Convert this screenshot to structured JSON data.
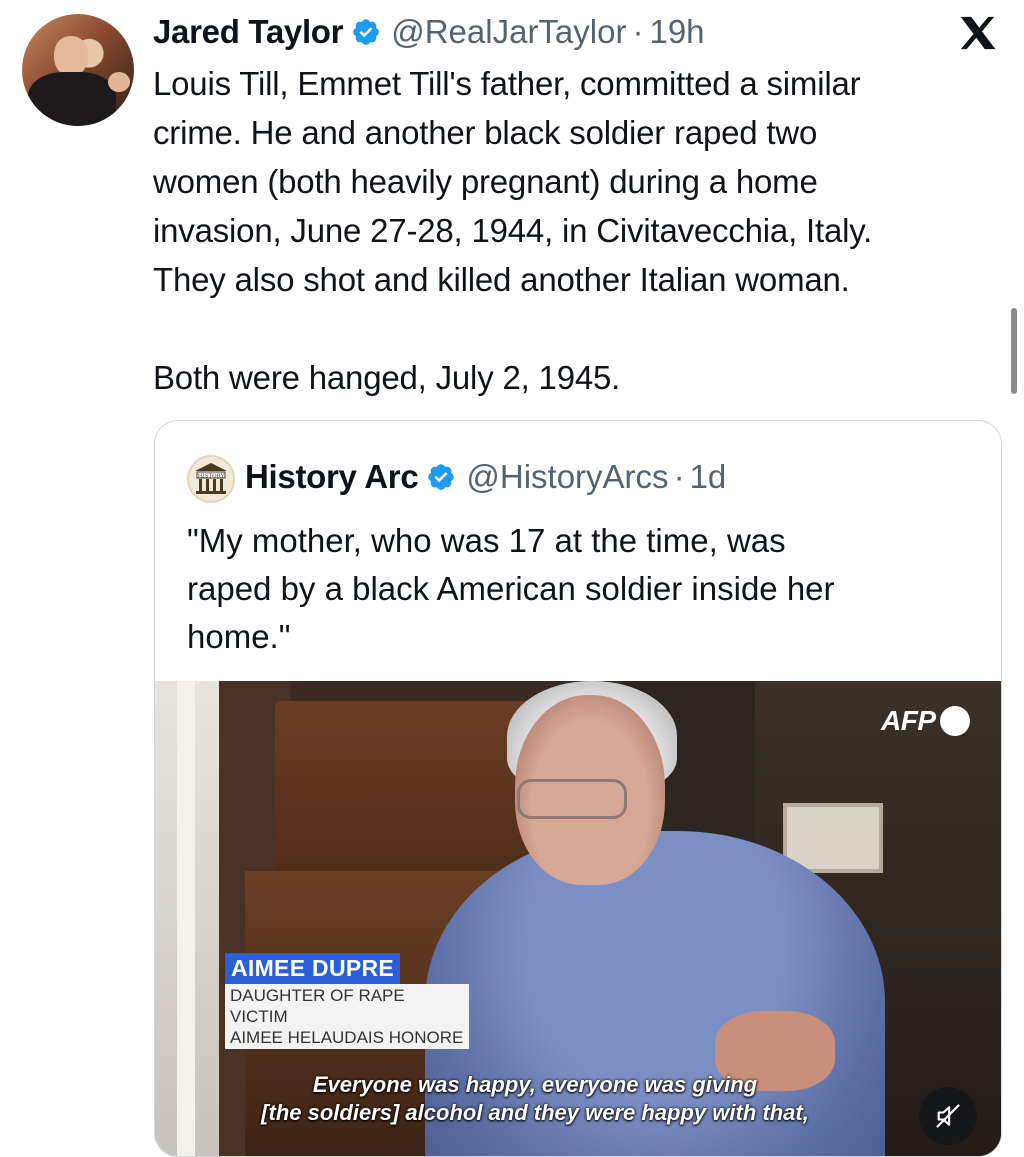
{
  "tweet": {
    "author_name": "Jared Taylor",
    "handle": "@RealJarTaylor",
    "separator": "·",
    "time": "19h",
    "text": "Louis Till, Emmet Till's father, committed a similar\ncrime. He and another black soldier raped two\nwomen (both heavily pregnant) during a home\ninvasion, June 27-28, 1944, in Civitavecchia, Italy.\nThey also shot and killed another Italian woman.\n\nBoth were hanged, July 2, 1945."
  },
  "quoted_tweet": {
    "author_name": "History Arc",
    "avatar_text": "HISTORY",
    "handle": "@HistoryArcs",
    "separator": "·",
    "time": "1d",
    "text": "\"My mother, who was 17 at the time, was\nraped by a black American soldier inside her\nhome.\"",
    "video": {
      "watermark": "AFP",
      "lower_third_name": "AIMEE DUPRE",
      "lower_third_desc": "DAUGHTER OF RAPE VICTIM\nAIMEE HELAUDAIS HONORE",
      "subtitle": "Everyone was happy, everyone was giving\n[the soldiers] alcohol and they were happy with that,"
    }
  },
  "icons": {
    "verified": "verified-badge-icon",
    "platform": "x-logo-icon",
    "mute": "muted-speaker-icon"
  },
  "colors": {
    "verified_blue": "#1d9bf0",
    "secondary_text": "#536471",
    "border": "#cfd9de",
    "lower_third_blue": "#2a5fd6"
  }
}
